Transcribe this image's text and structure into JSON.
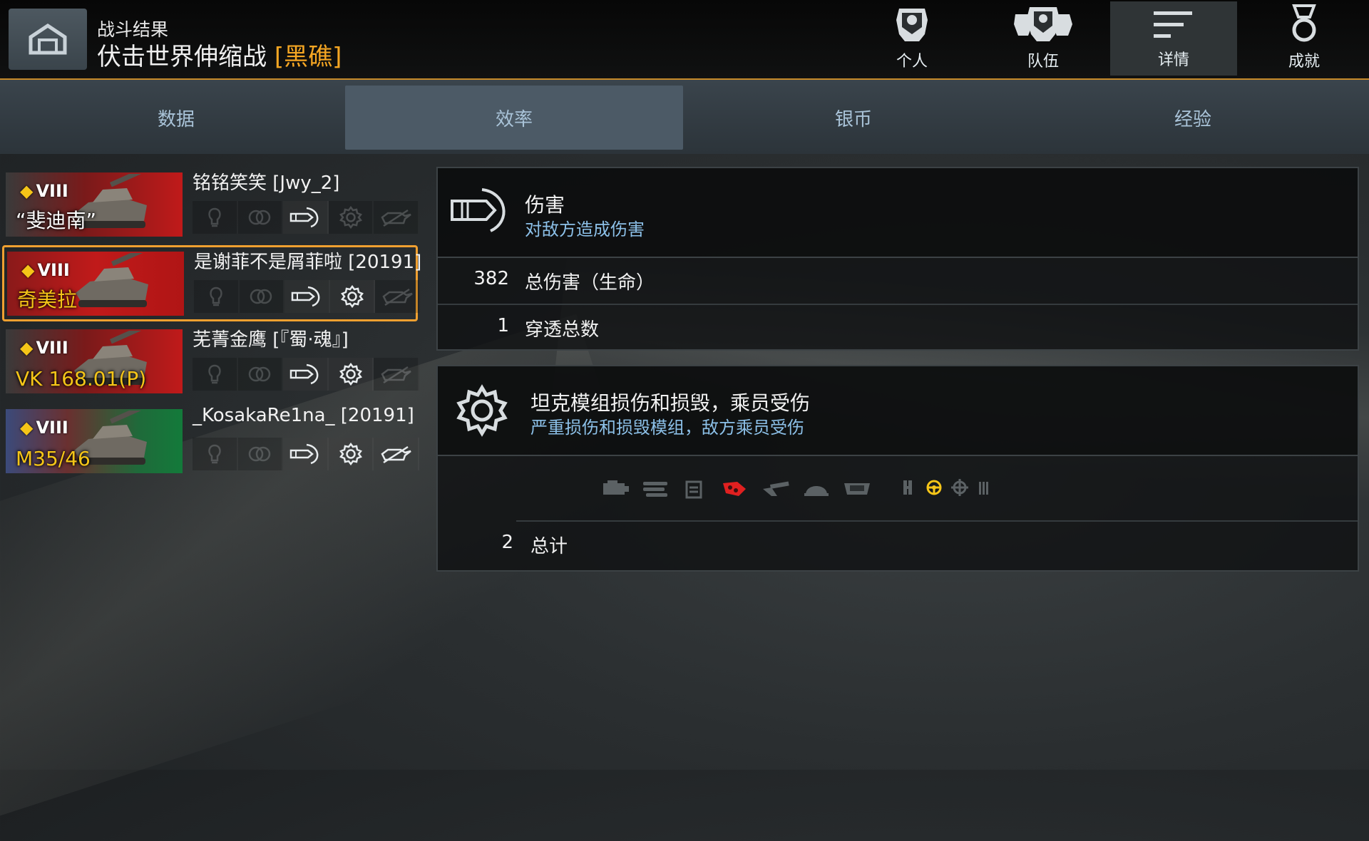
{
  "header": {
    "subtitle": "战斗结果",
    "mode": "伏击世界伸缩战",
    "map": "[黑礁]"
  },
  "nav": [
    {
      "label": "个人",
      "icon": "soldier-icon"
    },
    {
      "label": "队伍",
      "icon": "team-icon"
    },
    {
      "label": "详情",
      "icon": "details-icon"
    },
    {
      "label": "成就",
      "icon": "medal-icon"
    }
  ],
  "tabs": [
    "数据",
    "效率",
    "银币",
    "经验"
  ],
  "players": [
    {
      "name": "铭铭笑笑 [Jwy_2]",
      "tank": "“斐迪南”",
      "tier": "VIII",
      "flag": "germany",
      "name_color": "#ffffff",
      "active_icons": [
        false,
        false,
        true,
        false,
        false
      ]
    },
    {
      "name": "是谢菲不是屑菲啦 [20191]",
      "tank": "奇美拉",
      "tier": "VIII",
      "flag": "uk",
      "name_color": "#f5c518",
      "active_icons": [
        false,
        false,
        true,
        true,
        false
      ]
    },
    {
      "name": "芜菁金鹰 [『蜀·魂』]",
      "tank": "VK 168.01(P)",
      "tier": "VIII",
      "flag": "germany",
      "name_color": "#f5c518",
      "active_icons": [
        false,
        false,
        true,
        true,
        false
      ]
    },
    {
      "name": "_KosakaRe1na_ [20191]",
      "tank": "M35/46",
      "tier": "VIII",
      "flag": "eu",
      "name_color": "#f5c518",
      "active_icons": [
        false,
        false,
        true,
        true,
        true
      ]
    }
  ],
  "damage_panel": {
    "title": "伤害",
    "subtitle": "对敌方造成伤害",
    "rows": [
      {
        "value": "382",
        "label": "总伤害（生命）"
      },
      {
        "value": "1",
        "label": "穿透总数"
      }
    ]
  },
  "modules_panel": {
    "title": "坦克模组损伤和损毁，乘员受伤",
    "subtitle": "严重损伤和损毁模组，敌方乘员受伤",
    "modules": [
      "engine-icon",
      "tracks-icon",
      "fuel-tank-icon",
      "ammo-rack-icon",
      "gun-icon",
      "turret-icon",
      "hull-icon",
      "commander-icon",
      "driver-icon",
      "gunner-icon",
      "loader-icon"
    ],
    "highlighted": [
      "ammo-rack-icon",
      "driver-icon"
    ],
    "total_value": "2",
    "total_label": "总计"
  },
  "colors": {
    "accent": "#f0a030",
    "highlight_red": "#e02020",
    "highlight_yellow": "#f5c518",
    "subtitle_blue": "#8cc0e8"
  }
}
